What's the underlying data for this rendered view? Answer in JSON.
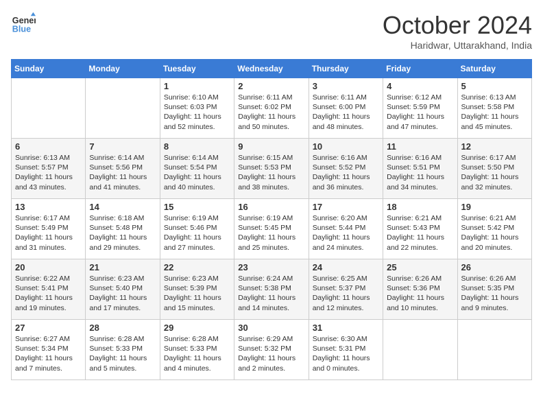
{
  "header": {
    "logo_line1": "General",
    "logo_line2": "Blue",
    "month": "October 2024",
    "location": "Haridwar, Uttarakhand, India"
  },
  "weekdays": [
    "Sunday",
    "Monday",
    "Tuesday",
    "Wednesday",
    "Thursday",
    "Friday",
    "Saturday"
  ],
  "weeks": [
    [
      {
        "day": "",
        "sunrise": "",
        "sunset": "",
        "daylight": ""
      },
      {
        "day": "",
        "sunrise": "",
        "sunset": "",
        "daylight": ""
      },
      {
        "day": "1",
        "sunrise": "Sunrise: 6:10 AM",
        "sunset": "Sunset: 6:03 PM",
        "daylight": "Daylight: 11 hours and 52 minutes."
      },
      {
        "day": "2",
        "sunrise": "Sunrise: 6:11 AM",
        "sunset": "Sunset: 6:02 PM",
        "daylight": "Daylight: 11 hours and 50 minutes."
      },
      {
        "day": "3",
        "sunrise": "Sunrise: 6:11 AM",
        "sunset": "Sunset: 6:00 PM",
        "daylight": "Daylight: 11 hours and 48 minutes."
      },
      {
        "day": "4",
        "sunrise": "Sunrise: 6:12 AM",
        "sunset": "Sunset: 5:59 PM",
        "daylight": "Daylight: 11 hours and 47 minutes."
      },
      {
        "day": "5",
        "sunrise": "Sunrise: 6:13 AM",
        "sunset": "Sunset: 5:58 PM",
        "daylight": "Daylight: 11 hours and 45 minutes."
      }
    ],
    [
      {
        "day": "6",
        "sunrise": "Sunrise: 6:13 AM",
        "sunset": "Sunset: 5:57 PM",
        "daylight": "Daylight: 11 hours and 43 minutes."
      },
      {
        "day": "7",
        "sunrise": "Sunrise: 6:14 AM",
        "sunset": "Sunset: 5:56 PM",
        "daylight": "Daylight: 11 hours and 41 minutes."
      },
      {
        "day": "8",
        "sunrise": "Sunrise: 6:14 AM",
        "sunset": "Sunset: 5:54 PM",
        "daylight": "Daylight: 11 hours and 40 minutes."
      },
      {
        "day": "9",
        "sunrise": "Sunrise: 6:15 AM",
        "sunset": "Sunset: 5:53 PM",
        "daylight": "Daylight: 11 hours and 38 minutes."
      },
      {
        "day": "10",
        "sunrise": "Sunrise: 6:16 AM",
        "sunset": "Sunset: 5:52 PM",
        "daylight": "Daylight: 11 hours and 36 minutes."
      },
      {
        "day": "11",
        "sunrise": "Sunrise: 6:16 AM",
        "sunset": "Sunset: 5:51 PM",
        "daylight": "Daylight: 11 hours and 34 minutes."
      },
      {
        "day": "12",
        "sunrise": "Sunrise: 6:17 AM",
        "sunset": "Sunset: 5:50 PM",
        "daylight": "Daylight: 11 hours and 32 minutes."
      }
    ],
    [
      {
        "day": "13",
        "sunrise": "Sunrise: 6:17 AM",
        "sunset": "Sunset: 5:49 PM",
        "daylight": "Daylight: 11 hours and 31 minutes."
      },
      {
        "day": "14",
        "sunrise": "Sunrise: 6:18 AM",
        "sunset": "Sunset: 5:48 PM",
        "daylight": "Daylight: 11 hours and 29 minutes."
      },
      {
        "day": "15",
        "sunrise": "Sunrise: 6:19 AM",
        "sunset": "Sunset: 5:46 PM",
        "daylight": "Daylight: 11 hours and 27 minutes."
      },
      {
        "day": "16",
        "sunrise": "Sunrise: 6:19 AM",
        "sunset": "Sunset: 5:45 PM",
        "daylight": "Daylight: 11 hours and 25 minutes."
      },
      {
        "day": "17",
        "sunrise": "Sunrise: 6:20 AM",
        "sunset": "Sunset: 5:44 PM",
        "daylight": "Daylight: 11 hours and 24 minutes."
      },
      {
        "day": "18",
        "sunrise": "Sunrise: 6:21 AM",
        "sunset": "Sunset: 5:43 PM",
        "daylight": "Daylight: 11 hours and 22 minutes."
      },
      {
        "day": "19",
        "sunrise": "Sunrise: 6:21 AM",
        "sunset": "Sunset: 5:42 PM",
        "daylight": "Daylight: 11 hours and 20 minutes."
      }
    ],
    [
      {
        "day": "20",
        "sunrise": "Sunrise: 6:22 AM",
        "sunset": "Sunset: 5:41 PM",
        "daylight": "Daylight: 11 hours and 19 minutes."
      },
      {
        "day": "21",
        "sunrise": "Sunrise: 6:23 AM",
        "sunset": "Sunset: 5:40 PM",
        "daylight": "Daylight: 11 hours and 17 minutes."
      },
      {
        "day": "22",
        "sunrise": "Sunrise: 6:23 AM",
        "sunset": "Sunset: 5:39 PM",
        "daylight": "Daylight: 11 hours and 15 minutes."
      },
      {
        "day": "23",
        "sunrise": "Sunrise: 6:24 AM",
        "sunset": "Sunset: 5:38 PM",
        "daylight": "Daylight: 11 hours and 14 minutes."
      },
      {
        "day": "24",
        "sunrise": "Sunrise: 6:25 AM",
        "sunset": "Sunset: 5:37 PM",
        "daylight": "Daylight: 11 hours and 12 minutes."
      },
      {
        "day": "25",
        "sunrise": "Sunrise: 6:26 AM",
        "sunset": "Sunset: 5:36 PM",
        "daylight": "Daylight: 11 hours and 10 minutes."
      },
      {
        "day": "26",
        "sunrise": "Sunrise: 6:26 AM",
        "sunset": "Sunset: 5:35 PM",
        "daylight": "Daylight: 11 hours and 9 minutes."
      }
    ],
    [
      {
        "day": "27",
        "sunrise": "Sunrise: 6:27 AM",
        "sunset": "Sunset: 5:34 PM",
        "daylight": "Daylight: 11 hours and 7 minutes."
      },
      {
        "day": "28",
        "sunrise": "Sunrise: 6:28 AM",
        "sunset": "Sunset: 5:33 PM",
        "daylight": "Daylight: 11 hours and 5 minutes."
      },
      {
        "day": "29",
        "sunrise": "Sunrise: 6:28 AM",
        "sunset": "Sunset: 5:33 PM",
        "daylight": "Daylight: 11 hours and 4 minutes."
      },
      {
        "day": "30",
        "sunrise": "Sunrise: 6:29 AM",
        "sunset": "Sunset: 5:32 PM",
        "daylight": "Daylight: 11 hours and 2 minutes."
      },
      {
        "day": "31",
        "sunrise": "Sunrise: 6:30 AM",
        "sunset": "Sunset: 5:31 PM",
        "daylight": "Daylight: 11 hours and 0 minutes."
      },
      {
        "day": "",
        "sunrise": "",
        "sunset": "",
        "daylight": ""
      },
      {
        "day": "",
        "sunrise": "",
        "sunset": "",
        "daylight": ""
      }
    ]
  ]
}
